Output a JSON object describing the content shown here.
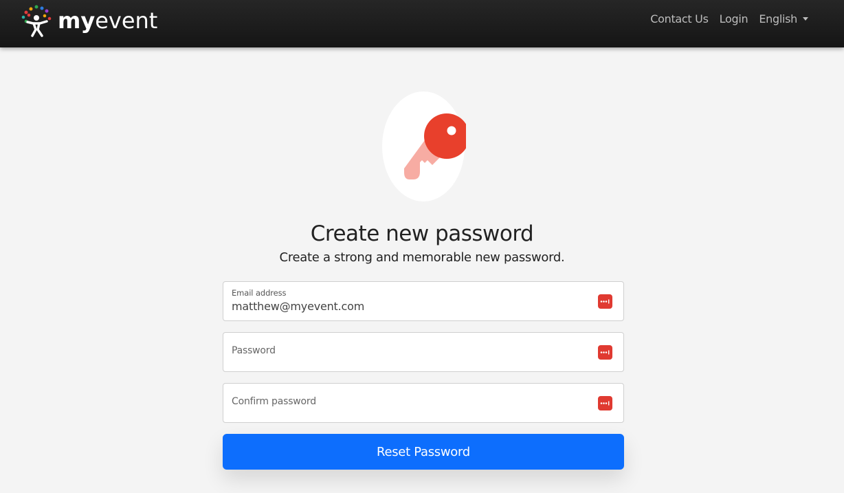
{
  "header": {
    "brand_bold": "my",
    "brand_light": "event",
    "nav": {
      "contact_label": "Contact Us",
      "login_label": "Login",
      "language_label": "English"
    },
    "logo_icon": "person-with-colored-dots-logo",
    "caret_icon": "caret-down-icon"
  },
  "illustration": {
    "icon": "key-icon",
    "colors": {
      "circle": "#ffffff",
      "key_head": "#e8402c",
      "key_shaft": "#f7aca3"
    }
  },
  "main": {
    "title": "Create new password",
    "subtitle": "Create a strong and memorable new password.",
    "form": {
      "email": {
        "label": "Email address",
        "value": "matthew@myevent.com"
      },
      "password": {
        "placeholder": "Password"
      },
      "confirm_password": {
        "placeholder": "Confirm password"
      },
      "submit_label": "Reset Password",
      "password_manager_icon": "password-manager-icon"
    }
  },
  "colors": {
    "header_bg": "#1b1b1b",
    "page_bg": "#f4f4f4",
    "primary": "#0d6efd",
    "pm_icon": "#e03a31"
  }
}
